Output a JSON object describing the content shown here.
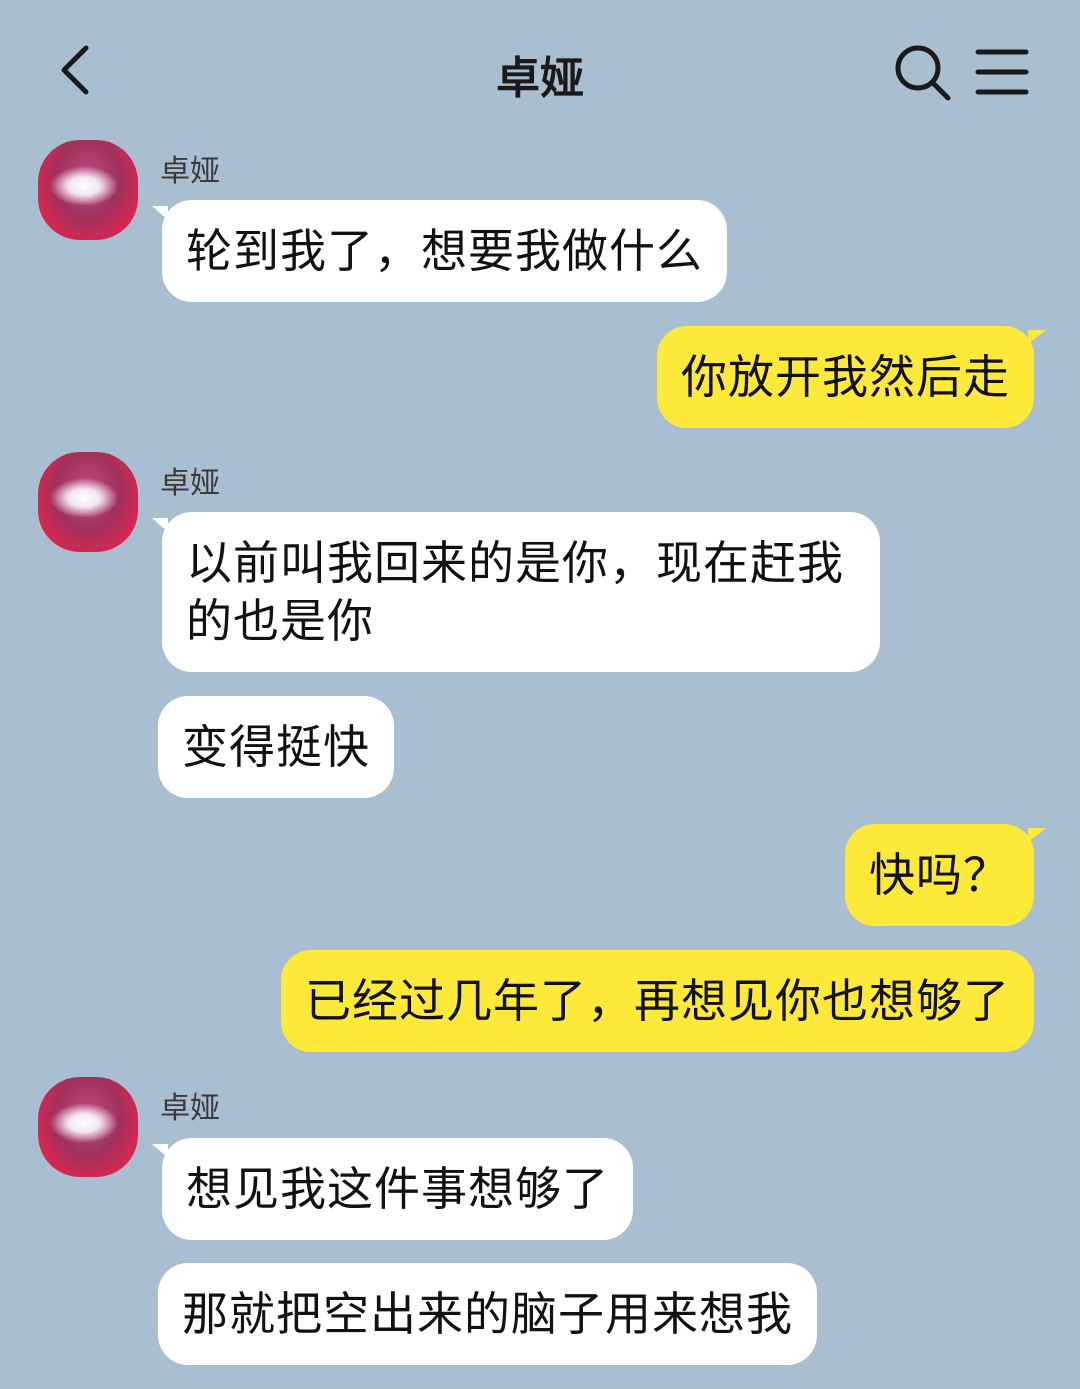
{
  "header": {
    "title": "卓娅"
  },
  "messages": [
    {
      "sender": "卓娅",
      "side": "in",
      "text": "轮到我了，想要我做什么"
    },
    {
      "side": "out",
      "text": "你放开我然后走"
    },
    {
      "sender": "卓娅",
      "side": "in",
      "text": "以前叫我回来的是你，现在赶我的也是你"
    },
    {
      "side": "in",
      "text": "变得挺快"
    },
    {
      "side": "out",
      "text": "快吗？"
    },
    {
      "side": "out",
      "text": "已经过几年了，再想见你也想够了"
    },
    {
      "sender": "卓娅",
      "side": "in",
      "text": "想见我这件事想够了"
    },
    {
      "side": "in",
      "text": "那就把空出来的脑子用来想我"
    }
  ],
  "colors": {
    "background": "#aabed2",
    "incoming_bubble": "#ffffff",
    "outgoing_bubble": "#fde93a"
  },
  "icons": [
    "chevron-left-icon",
    "search-icon",
    "hamburger-menu-icon"
  ]
}
